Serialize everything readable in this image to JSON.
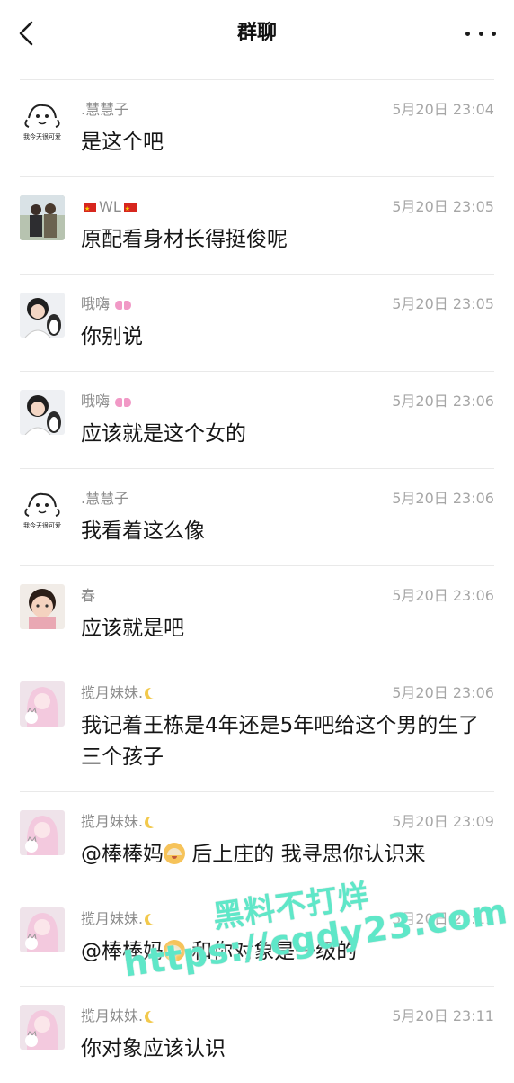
{
  "header": {
    "title": "群聊"
  },
  "messages": [
    {
      "name": ".慧慧子",
      "time": "5月20日 23:04",
      "text": "是这个吧",
      "avatar": "doodle-sketch"
    },
    {
      "name": "WL",
      "time": "5月20日 23:05",
      "text": "原配看身材长得挺俊呢",
      "avatar": "couple-photo"
    },
    {
      "name": "哦嗨",
      "time": "5月20日 23:05",
      "text": "你别说",
      "avatar": "girl-with-penguin"
    },
    {
      "name": "哦嗨",
      "time": "5月20日 23:06",
      "text": "应该就是这个女的",
      "avatar": "girl-with-penguin"
    },
    {
      "name": ".慧慧子",
      "time": "5月20日 23:06",
      "text": "我看着这么像",
      "avatar": "doodle-sketch"
    },
    {
      "name": "春",
      "time": "5月20日 23:06",
      "text": "应该就是吧",
      "avatar": "baby-photo"
    },
    {
      "name": "揽月妹妹.",
      "time": "5月20日 23:06",
      "text": "我记着王栋是4年还是5年吧给这个男的生了三个孩子",
      "avatar": "anime-girl-cat"
    },
    {
      "name": "揽月妹妹.",
      "time": "5月20日 23:09",
      "text_a": "@棒棒妈",
      "text_b": " 后上庄的 我寻思你认识来",
      "avatar": "anime-girl-cat"
    },
    {
      "name": "揽月妹妹.",
      "time": "5月20日 23:11",
      "text_a": "@棒棒妈",
      "text_b": " 和你对象是一级的",
      "avatar": "anime-girl-cat"
    },
    {
      "name": "揽月妹妹.",
      "time": "5月20日 23:11",
      "text": "你对象应该认识",
      "avatar": "anime-girl-cat"
    }
  ],
  "watermark": {
    "line1": "黑料不打烊",
    "line2": "https://cgdy23.com"
  },
  "colors": {
    "name": "#8c8c8c",
    "time": "#a6a6a6",
    "divider": "#e9e9e9",
    "watermark": "#5fe7c8"
  }
}
